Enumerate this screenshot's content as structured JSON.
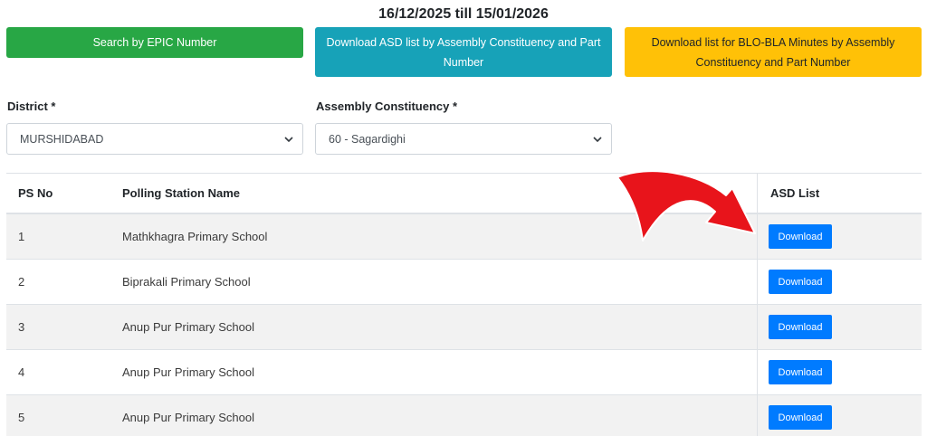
{
  "header": {
    "date_range": "16/12/2025 till 15/01/2026"
  },
  "buttons": {
    "search_epic": "Search by EPIC Number",
    "download_asd": "Download ASD list by Assembly Constituency and Part Number",
    "download_blo": "Download list for BLO-BLA Minutes by Assembly Constituency and Part Number"
  },
  "filters": {
    "district_label": "District *",
    "district_value": "MURSHIDABAD",
    "ac_label": "Assembly Constituency *",
    "ac_value": "60 - Sagardighi"
  },
  "table": {
    "headers": {
      "ps_no": "PS No",
      "name": "Polling Station Name",
      "asd": "ASD List"
    },
    "rows": [
      {
        "ps_no": "1",
        "name": "Mathkhagra Primary School",
        "action": "Download"
      },
      {
        "ps_no": "2",
        "name": "Biprakali Primary School",
        "action": "Download"
      },
      {
        "ps_no": "3",
        "name": "Anup Pur Primary School",
        "action": "Download"
      },
      {
        "ps_no": "4",
        "name": "Anup Pur Primary School",
        "action": "Download"
      },
      {
        "ps_no": "5",
        "name": "Anup Pur Primary School",
        "action": "Download"
      }
    ]
  },
  "colors": {
    "green": "#28a745",
    "teal": "#17a2b8",
    "yellow": "#ffc107",
    "blue": "#007bff",
    "arrow": "#e8141b"
  },
  "icons": {
    "select_chevron": "chevron-down-icon",
    "annotation": "red-curved-arrow-icon"
  }
}
